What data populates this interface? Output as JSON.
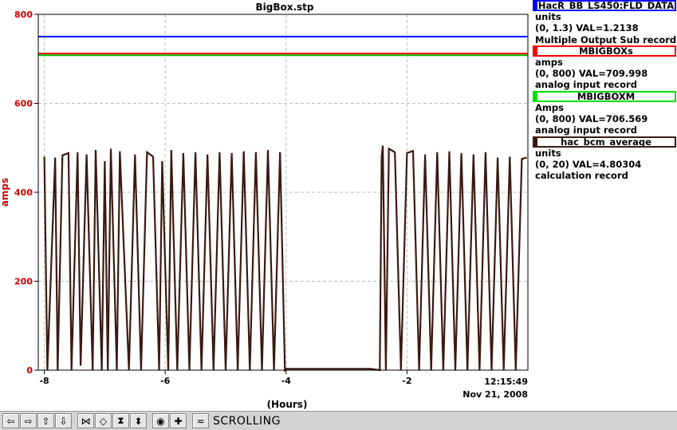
{
  "chart_data": {
    "type": "line",
    "title": "BigBox.stp",
    "xlabel": "(Hours)",
    "ylabel": "amps",
    "x_unit": "hours",
    "xlim": [
      -8.1,
      0
    ],
    "ylim": [
      0,
      800
    ],
    "x_ticks": [
      -8,
      -6,
      -4,
      -2
    ],
    "y_ticks": [
      0,
      200,
      400,
      600,
      800
    ],
    "grid": true,
    "time_label": "12:15:49",
    "date_label": "Nov 21, 2008",
    "series": [
      {
        "name": "HacR_BB_LS450:FLD_DATA",
        "color": "#0000ff",
        "units": "units",
        "range": "(0, 1.3) VAL=1.2138",
        "record": "Multiple Output Sub record",
        "x": [
          -8.1,
          0
        ],
        "y": [
          750,
          750
        ]
      },
      {
        "name": "MBIGBOXs",
        "color": "#ff0000",
        "units": "amps",
        "range": "(0, 800) VAL=709.998",
        "record": "analog input record",
        "x": [
          -8.1,
          0
        ],
        "y": [
          712,
          712
        ]
      },
      {
        "name": "MBIGBOXM",
        "color": "#00c000",
        "units": "Amps",
        "range": "(0, 800) VAL=706.569",
        "record": "analog input record",
        "x": [
          -8.1,
          0
        ],
        "y": [
          708,
          708
        ]
      },
      {
        "name": "hac_bcm_average",
        "color": "#3a1a10",
        "units": "units",
        "range": "(0, 20) VAL=4.80304",
        "record": "calculation record",
        "x": [
          -8.0,
          -7.95,
          -7.82,
          -7.78,
          -7.7,
          -7.6,
          -7.55,
          -7.45,
          -7.4,
          -7.3,
          -7.2,
          -7.15,
          -7.05,
          -7.0,
          -6.95,
          -6.9,
          -6.8,
          -6.75,
          -6.6,
          -6.5,
          -6.4,
          -6.3,
          -6.2,
          -6.1,
          -6.05,
          -5.95,
          -5.9,
          -5.8,
          -5.7,
          -5.6,
          -5.5,
          -5.4,
          -5.3,
          -5.2,
          -5.1,
          -5.0,
          -4.9,
          -4.8,
          -4.7,
          -4.6,
          -4.5,
          -4.4,
          -4.3,
          -4.2,
          -4.1,
          -4.02,
          -4.0,
          -3.5,
          -3.0,
          -2.6,
          -2.45,
          -2.42,
          -2.4,
          -2.35,
          -2.3,
          -2.2,
          -2.1,
          -2.0,
          -1.9,
          -1.8,
          -1.7,
          -1.6,
          -1.5,
          -1.4,
          -1.3,
          -1.2,
          -1.1,
          -1.0,
          -0.9,
          -0.8,
          -0.7,
          -0.6,
          -0.5,
          -0.4,
          -0.3,
          -0.2,
          -0.1,
          -0.02
        ],
        "y": [
          480,
          0,
          478,
          0,
          483,
          488,
          0,
          490,
          10,
          485,
          0,
          495,
          0,
          470,
          0,
          498,
          0,
          492,
          0,
          485,
          0,
          490,
          480,
          0,
          470,
          0,
          495,
          0,
          488,
          0,
          490,
          0,
          485,
          0,
          490,
          0,
          488,
          0,
          492,
          0,
          490,
          0,
          495,
          0,
          490,
          0,
          3,
          3,
          3,
          3,
          0,
          480,
          505,
          0,
          498,
          490,
          0,
          488,
          493,
          0,
          485,
          0,
          490,
          0,
          492,
          0,
          488,
          0,
          485,
          0,
          490,
          0,
          478,
          0,
          480,
          0,
          475,
          478
        ]
      }
    ]
  },
  "toolbar": {
    "buttons": [
      {
        "icon": "arrow-left-icon",
        "glyph": "⇦"
      },
      {
        "icon": "arrow-right-icon",
        "glyph": "⇨"
      },
      {
        "icon": "arrow-up-icon",
        "glyph": "⇧"
      },
      {
        "icon": "arrow-down-icon",
        "glyph": "⇩"
      },
      {
        "icon": "zoom-in-x-icon",
        "glyph": "⋈"
      },
      {
        "icon": "zoom-out-x-icon",
        "glyph": "◇"
      },
      {
        "icon": "zoom-in-y-icon",
        "glyph": "⧗"
      },
      {
        "icon": "zoom-out-y-icon",
        "glyph": "⬍"
      },
      {
        "icon": "zoom-reset-icon",
        "glyph": "◉"
      },
      {
        "icon": "cross-icon",
        "glyph": "✚"
      },
      {
        "icon": "scroll-mode-icon",
        "glyph": "≂"
      }
    ],
    "status": "SCROLLING"
  }
}
